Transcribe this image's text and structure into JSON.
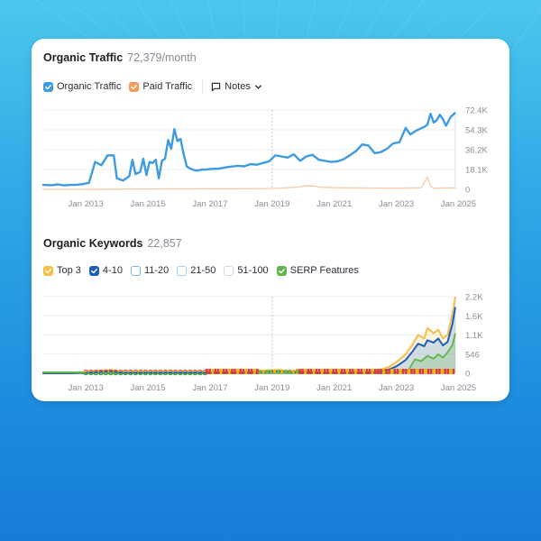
{
  "colors": {
    "organic": "#3f9be0",
    "paid": "#f39a5a",
    "top3": "#f4c04a",
    "pos4_10": "#1d5fb8",
    "pos11_20": "#7fb1e6",
    "serp": "#5fb548",
    "grid": "#ececef"
  },
  "traffic": {
    "title": "Organic Traffic",
    "metric": "72,379/month",
    "legend": [
      {
        "label": "Organic Traffic",
        "checked": true,
        "color": "#3f9be0"
      },
      {
        "label": "Paid Traffic",
        "checked": true,
        "color": "#f39a5a"
      }
    ],
    "notes_label": "Notes"
  },
  "keywords": {
    "title": "Organic Keywords",
    "metric": "22,857",
    "legend": [
      {
        "label": "Top 3",
        "checked": true,
        "color": "#f4c04a"
      },
      {
        "label": "4-10",
        "checked": true,
        "color": "#1d5fb8"
      },
      {
        "label": "11-20",
        "checked": false,
        "color": "#9fc4e8"
      },
      {
        "label": "21-50",
        "checked": false,
        "color": "#b8d3ee"
      },
      {
        "label": "51-100",
        "checked": false,
        "color": "#d3e3f3"
      },
      {
        "label": "SERP Features",
        "checked": true,
        "color": "#5fb548"
      }
    ]
  },
  "chart_data": [
    {
      "type": "line",
      "title": "Organic Traffic",
      "xlabel": "",
      "ylabel": "",
      "x_ticks": [
        "Jan 2013",
        "Jan 2015",
        "Jan 2017",
        "Jan 2019",
        "Jan 2021",
        "Jan 2023",
        "Jan 2025"
      ],
      "y_ticks": [
        "0",
        "18.1K",
        "36.2K",
        "54.3K",
        "72.4K"
      ],
      "xlim": [
        2011.6,
        2024.9
      ],
      "ylim": [
        0,
        72400
      ],
      "grid": true,
      "series": [
        {
          "name": "Organic Traffic",
          "x": [
            2011.6,
            2011.9,
            2012.1,
            2012.3,
            2012.5,
            2012.7,
            2012.9,
            2013.1,
            2013.3,
            2013.5,
            2013.7,
            2013.9,
            2014.0,
            2014.2,
            2014.4,
            2014.5,
            2014.6,
            2014.75,
            2014.85,
            2014.95,
            2015.05,
            2015.15,
            2015.25,
            2015.35,
            2015.45,
            2015.55,
            2015.65,
            2015.75,
            2015.85,
            2015.95,
            2016.05,
            2016.15,
            2016.25,
            2016.35,
            2016.45,
            2016.55,
            2016.65,
            2016.75,
            2016.85,
            2017.0,
            2017.3,
            2017.6,
            2017.9,
            2018.1,
            2018.3,
            2018.5,
            2018.7,
            2018.9,
            2019.1,
            2019.3,
            2019.5,
            2019.7,
            2019.9,
            2020.1,
            2020.3,
            2020.5,
            2020.7,
            2020.9,
            2021.1,
            2021.3,
            2021.5,
            2021.7,
            2021.9,
            2022.1,
            2022.3,
            2022.5,
            2022.7,
            2022.9,
            2023.1,
            2023.3,
            2023.45,
            2023.6,
            2023.75,
            2023.9,
            2024.0,
            2024.1,
            2024.2,
            2024.3,
            2024.4,
            2024.5,
            2024.6,
            2024.75,
            2024.9
          ],
          "values": [
            4000,
            3800,
            4500,
            3600,
            4000,
            4200,
            4800,
            6000,
            25000,
            22000,
            31000,
            31000,
            10000,
            8000,
            12000,
            27000,
            14000,
            16000,
            28000,
            13000,
            25000,
            24000,
            27000,
            10000,
            26000,
            28000,
            45000,
            37000,
            55000,
            44000,
            46000,
            32000,
            21000,
            19000,
            18000,
            17000,
            17500,
            18000,
            18000,
            18500,
            19000,
            20500,
            21500,
            21000,
            23000,
            22500,
            24000,
            25500,
            31000,
            30000,
            29000,
            32000,
            26000,
            30000,
            31500,
            27000,
            26000,
            25000,
            25500,
            27500,
            31000,
            35000,
            41000,
            40000,
            33000,
            34000,
            37000,
            42000,
            43000,
            56000,
            50000,
            53000,
            55000,
            57000,
            59000,
            69000,
            61000,
            63000,
            68000,
            64000,
            58000,
            66000,
            70000
          ]
        },
        {
          "name": "Paid Traffic",
          "x": [
            2011.6,
            2013.0,
            2015.0,
            2017.0,
            2018.0,
            2019.0,
            2019.8,
            2020.2,
            2020.6,
            2021.0,
            2022.0,
            2023.0,
            2023.8,
            2024.0,
            2024.1,
            2024.2,
            2024.9
          ],
          "values": [
            0,
            0,
            300,
            500,
            600,
            800,
            2000,
            3500,
            2000,
            1500,
            1200,
            1000,
            1500,
            11000,
            3000,
            1000,
            1500
          ]
        }
      ]
    },
    {
      "type": "area",
      "title": "Organic Keywords",
      "xlabel": "",
      "ylabel": "",
      "x_ticks": [
        "Jan 2013",
        "Jan 2015",
        "Jan 2017",
        "Jan 2019",
        "Jan 2021",
        "Jan 2023",
        "Jan 2025"
      ],
      "y_ticks": [
        "0",
        "546",
        "1.1K",
        "1.6K",
        "2.2K"
      ],
      "xlim": [
        2011.6,
        2024.9
      ],
      "ylim": [
        0,
        2200
      ],
      "grid": true,
      "series": [
        {
          "name": "Top 3",
          "x": [
            2011.6,
            2012.5,
            2013.0,
            2013.8,
            2014.2,
            2015.0,
            2016.0,
            2017.0,
            2018.0,
            2018.8,
            2019.2,
            2019.6,
            2020.0,
            2020.5,
            2021.0,
            2021.5,
            2022.0,
            2022.5,
            2022.8,
            2023.0,
            2023.3,
            2023.5,
            2023.7,
            2023.9,
            2024.0,
            2024.2,
            2024.35,
            2024.5,
            2024.65,
            2024.8,
            2024.9
          ],
          "values": [
            0,
            0,
            30,
            100,
            30,
            40,
            40,
            40,
            40,
            80,
            100,
            60,
            70,
            30,
            20,
            30,
            40,
            100,
            200,
            320,
            550,
            800,
            1100,
            1000,
            1300,
            1150,
            1250,
            1000,
            1100,
            1700,
            2200
          ]
        },
        {
          "name": "4-10",
          "x": [
            2011.6,
            2012.5,
            2013.0,
            2013.8,
            2014.2,
            2015.0,
            2016.0,
            2017.0,
            2018.0,
            2018.8,
            2019.2,
            2019.6,
            2020.0,
            2020.5,
            2021.0,
            2021.5,
            2022.0,
            2022.5,
            2022.8,
            2023.0,
            2023.3,
            2023.5,
            2023.7,
            2023.9,
            2024.0,
            2024.2,
            2024.35,
            2024.5,
            2024.65,
            2024.8,
            2024.9
          ],
          "values": [
            0,
            0,
            15,
            60,
            15,
            20,
            20,
            20,
            20,
            40,
            60,
            30,
            40,
            15,
            10,
            15,
            20,
            50,
            120,
            200,
            380,
            600,
            850,
            780,
            950,
            880,
            1000,
            800,
            900,
            1400,
            1900
          ]
        },
        {
          "name": "SERP Features",
          "x": [
            2011.6,
            2012.5,
            2013.0,
            2015.0,
            2017.0,
            2019.0,
            2021.0,
            2022.5,
            2023.0,
            2023.4,
            2023.6,
            2023.8,
            2024.0,
            2024.2,
            2024.35,
            2024.5,
            2024.65,
            2024.8,
            2024.9
          ],
          "values": [
            0,
            0,
            0,
            0,
            0,
            0,
            0,
            0,
            30,
            100,
            400,
            350,
            500,
            420,
            550,
            450,
            600,
            800,
            1150
          ]
        }
      ]
    }
  ]
}
